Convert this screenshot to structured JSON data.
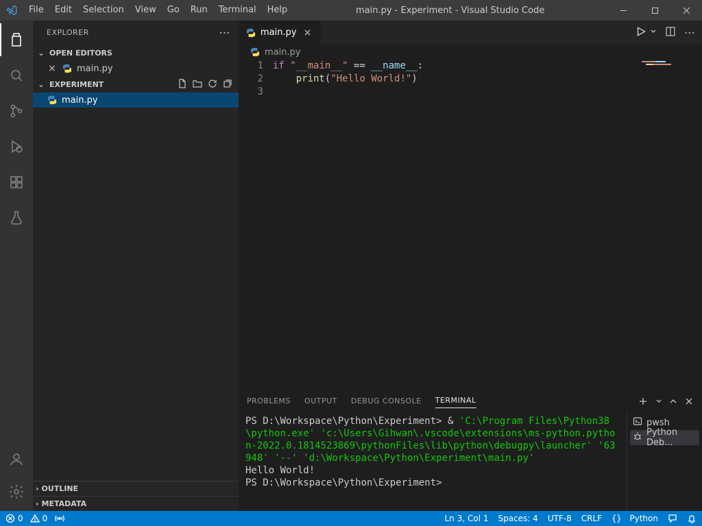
{
  "titlebar": {
    "menus": [
      "File",
      "Edit",
      "Selection",
      "View",
      "Go",
      "Run",
      "Terminal",
      "Help"
    ],
    "title": "main.py - Experiment - Visual Studio Code"
  },
  "sidebar": {
    "title": "EXPLORER",
    "openEditorsLabel": "OPEN EDITORS",
    "openEditors": [
      {
        "name": "main.py"
      }
    ],
    "folderLabel": "EXPERIMENT",
    "files": [
      {
        "name": "main.py",
        "selected": true
      }
    ],
    "collapsedSections": [
      "OUTLINE",
      "METADATA"
    ]
  },
  "editor": {
    "tab": {
      "name": "main.py"
    },
    "breadcrumb": "main.py",
    "lines": [
      {
        "n": "1",
        "tokens": [
          {
            "t": "if ",
            "c": "kw"
          },
          {
            "t": "\"__main__\"",
            "c": "str"
          },
          {
            "t": " == ",
            "c": "pn"
          },
          {
            "t": "__name__",
            "c": "var"
          },
          {
            "t": ":",
            "c": "pn"
          }
        ]
      },
      {
        "n": "2",
        "tokens": [
          {
            "t": "    ",
            "c": "pn"
          },
          {
            "t": "print",
            "c": "fn"
          },
          {
            "t": "(",
            "c": "pn"
          },
          {
            "t": "\"Hello World!\"",
            "c": "str"
          },
          {
            "t": ")",
            "c": "pn"
          }
        ]
      },
      {
        "n": "3",
        "tokens": []
      }
    ]
  },
  "panel": {
    "tabs": [
      "PROBLEMS",
      "OUTPUT",
      "DEBUG CONSOLE",
      "TERMINAL"
    ],
    "activeTab": "TERMINAL",
    "terminals": [
      {
        "name": "pwsh",
        "icon": "shell"
      },
      {
        "name": "Python Deb...",
        "icon": "debug",
        "active": true
      }
    ],
    "lines": [
      [
        {
          "t": "PS ",
          "c": ""
        },
        {
          "t": "D:\\Workspace\\Python\\Experiment>",
          "c": ""
        },
        {
          "t": " & ",
          "c": ""
        },
        {
          "t": "'C:\\Program Files\\Python38\\python.exe' 'c:\\Users\\Gihwan\\.vscode\\extensions\\ms-python.python-2022.0.1814523869\\pythonFiles\\lib\\python\\debugpy\\launcher' '63948' '--' 'd:\\Workspace\\Python\\Experiment\\main.py'",
          "c": "path"
        }
      ],
      [
        {
          "t": "Hello World!",
          "c": ""
        }
      ],
      [
        {
          "t": "PS ",
          "c": ""
        },
        {
          "t": "D:\\Workspace\\Python\\Experiment>",
          "c": ""
        }
      ]
    ]
  },
  "statusbar": {
    "errors": "0",
    "warnings": "0",
    "lncol": "Ln 3, Col 1",
    "spaces": "Spaces: 4",
    "encoding": "UTF-8",
    "eol": "CRLF",
    "lang": "Python"
  },
  "colors": {
    "accent": "#007acc"
  }
}
